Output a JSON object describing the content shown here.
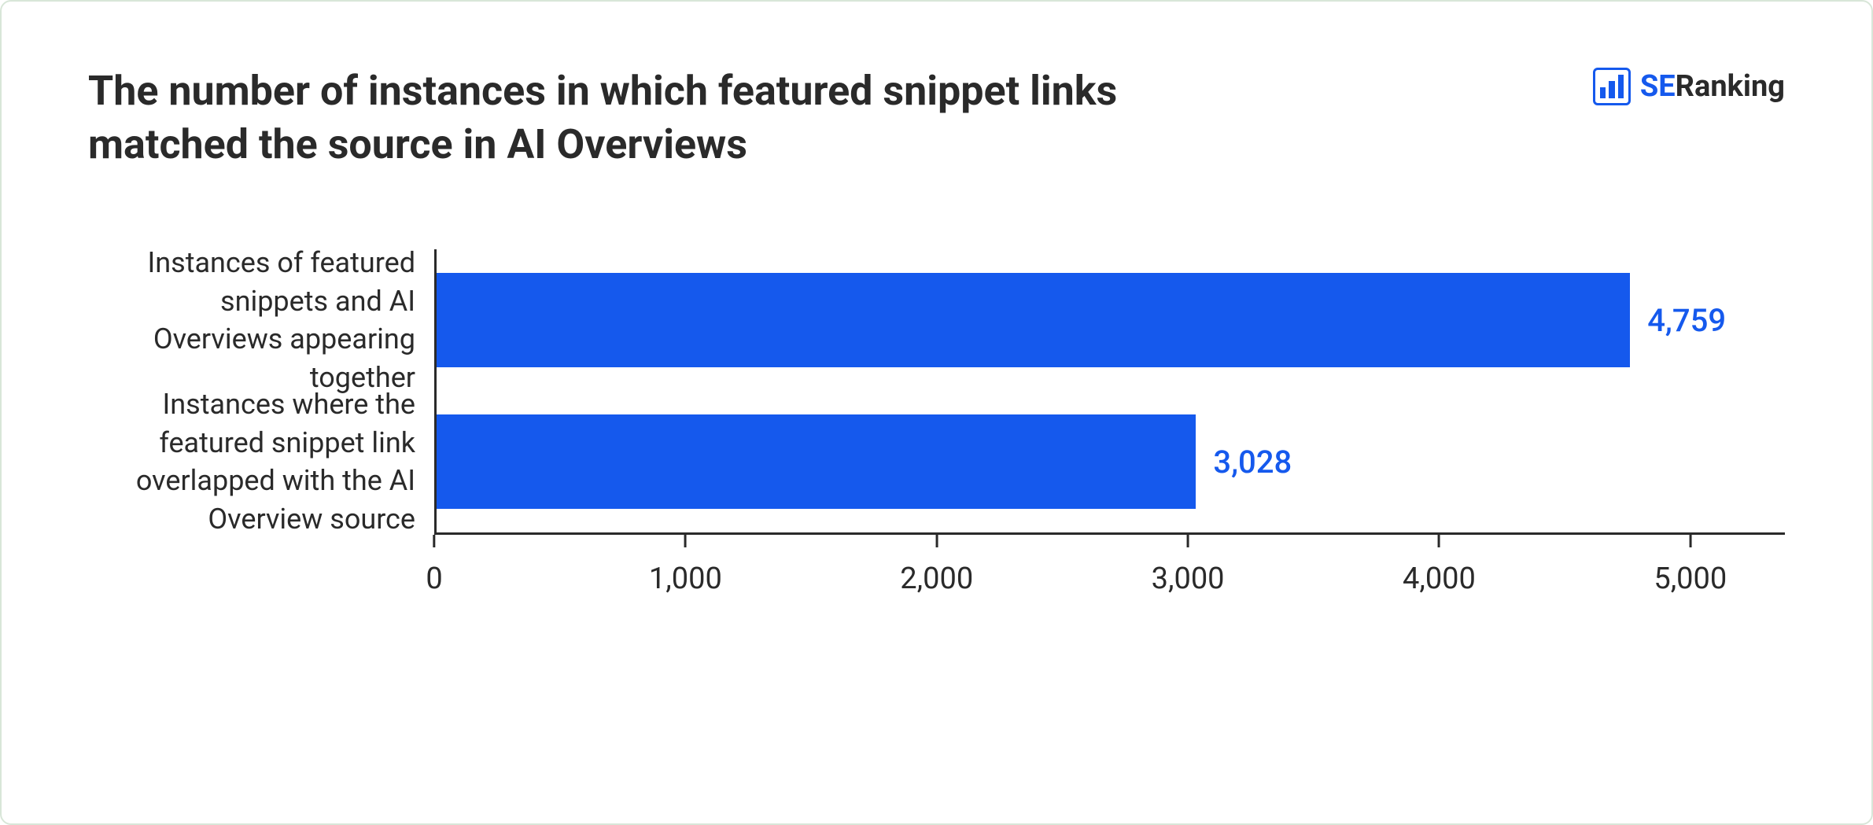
{
  "title": "The number of instances in which featured snippet links matched the source in AI Overviews",
  "logo": {
    "se": "SE",
    "ranking": "Ranking"
  },
  "chart_data": {
    "type": "bar",
    "orientation": "horizontal",
    "categories": [
      "Instances of featured snippets and AI Overviews appearing together",
      "Instances where the featured snippet link overlapped with the AI Overview source"
    ],
    "values": [
      4759,
      3028
    ],
    "value_labels": [
      "4,759",
      "3,028"
    ],
    "xlim": [
      0,
      5000
    ],
    "xticks": [
      0,
      1000,
      2000,
      3000,
      4000,
      5000
    ],
    "xtick_labels": [
      "0",
      "1,000",
      "2,000",
      "3,000",
      "4,000",
      "5,000"
    ],
    "bar_color": "#1559ED"
  }
}
